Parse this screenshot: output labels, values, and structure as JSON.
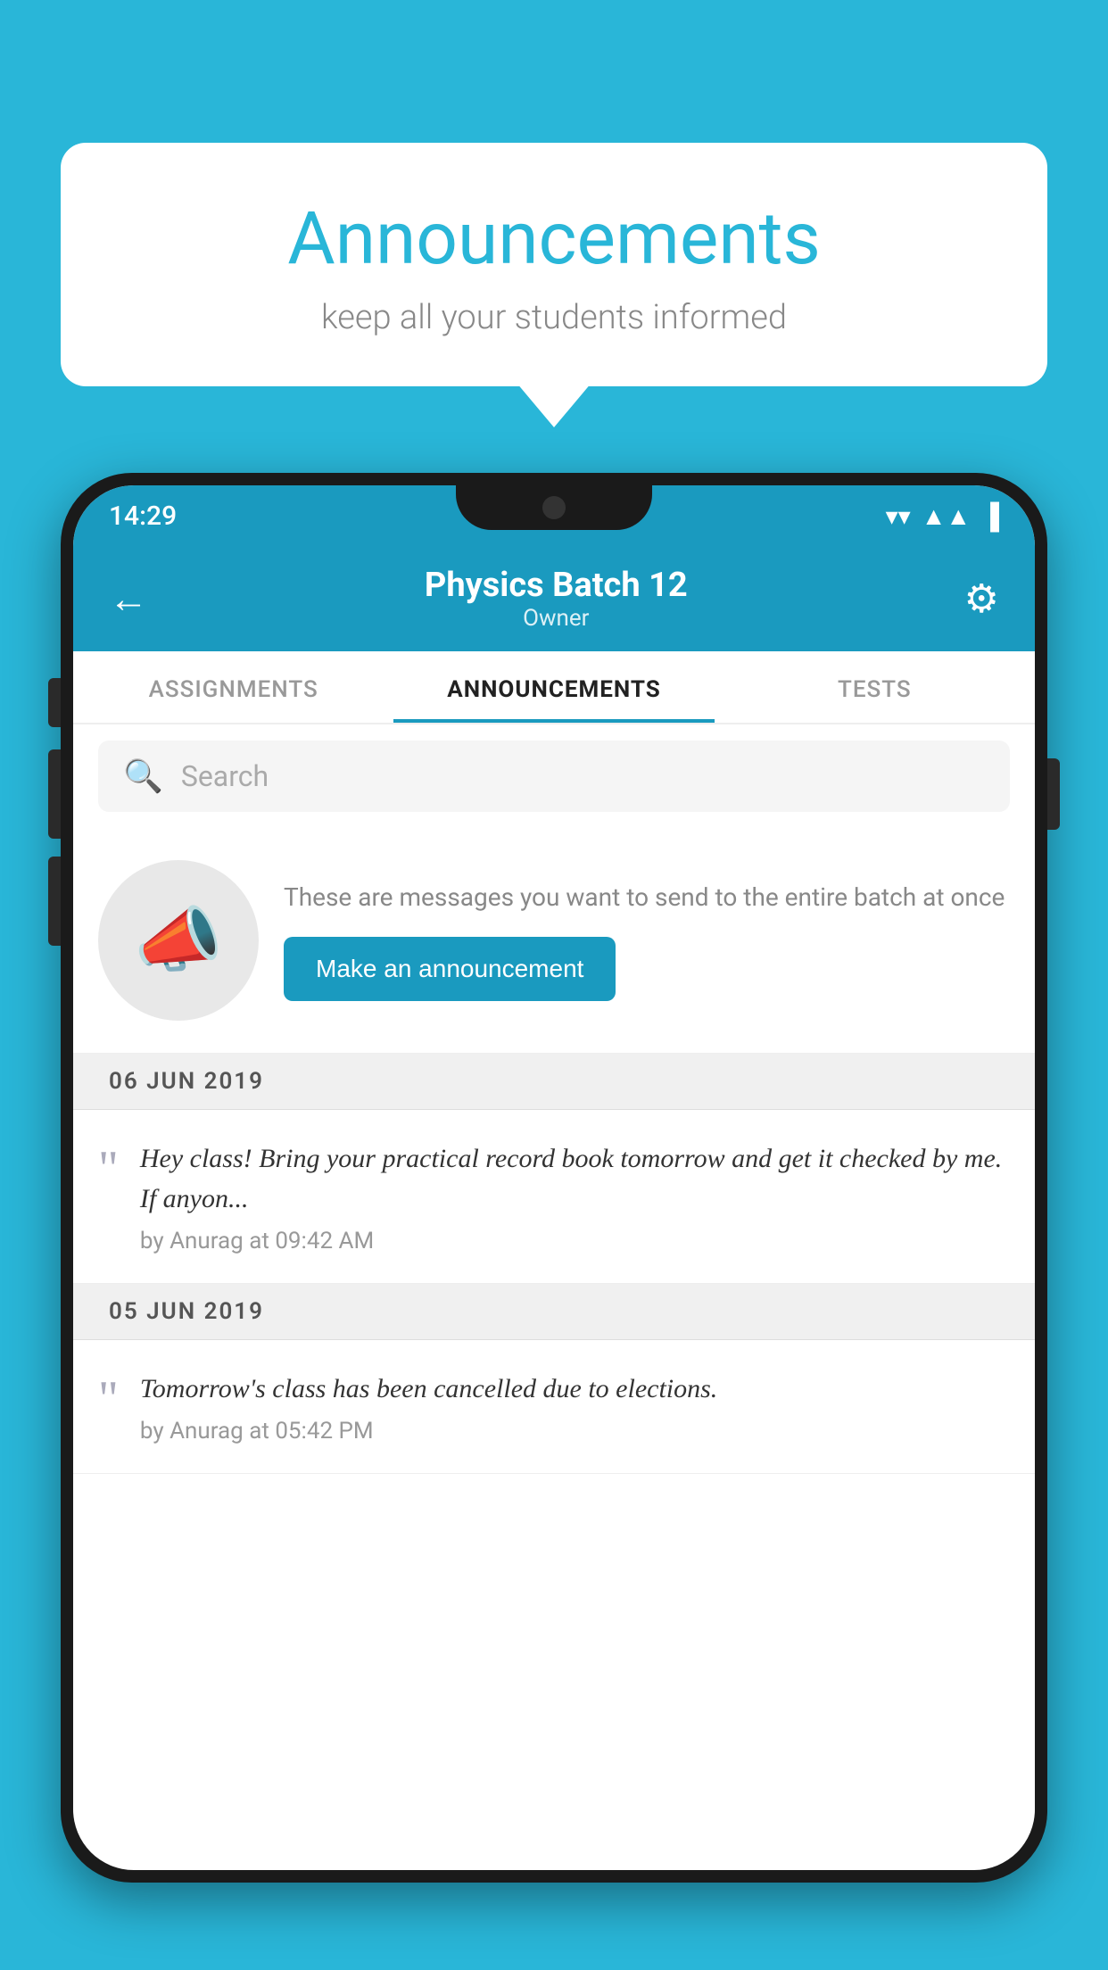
{
  "background_color": "#29b6d8",
  "speech_bubble": {
    "title": "Announcements",
    "subtitle": "keep all your students informed"
  },
  "phone": {
    "status_bar": {
      "time": "14:29",
      "icons": [
        "wifi",
        "signal",
        "battery"
      ]
    },
    "header": {
      "back_label": "←",
      "title": "Physics Batch 12",
      "subtitle": "Owner",
      "gear_label": "⚙"
    },
    "tabs": [
      {
        "label": "ASSIGNMENTS",
        "active": false
      },
      {
        "label": "ANNOUNCEMENTS",
        "active": true
      },
      {
        "label": "TESTS",
        "active": false
      }
    ],
    "search": {
      "placeholder": "Search"
    },
    "announcement_prompt": {
      "description": "These are messages you want to send to the entire batch at once",
      "button_label": "Make an announcement"
    },
    "announcements": [
      {
        "date": "06  JUN  2019",
        "text": "Hey class! Bring your practical record book tomorrow and get it checked by me. If anyon...",
        "meta": "by Anurag at 09:42 AM"
      },
      {
        "date": "05  JUN  2019",
        "text": "Tomorrow's class has been cancelled due to elections.",
        "meta": "by Anurag at 05:42 PM"
      }
    ]
  }
}
